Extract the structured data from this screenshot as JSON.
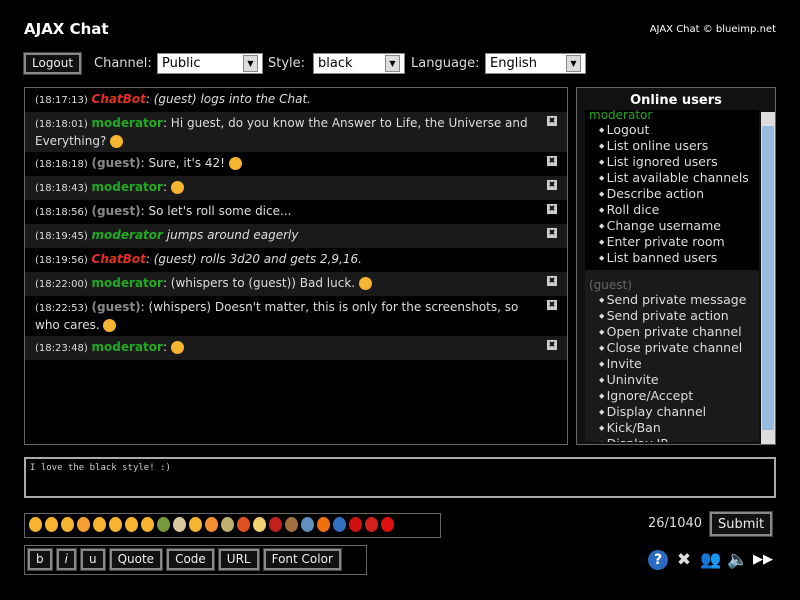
{
  "header": {
    "title": "AJAX Chat",
    "credit": "AJAX Chat © blueimp.net"
  },
  "toolbar": {
    "logout": "Logout",
    "channel_label": "Channel:",
    "channel": "Public",
    "style_label": "Style:",
    "style": "black",
    "language_label": "Language:",
    "language": "English"
  },
  "messages": [
    {
      "time": "(18:17:13)",
      "user": "ChatBot",
      "type": "bot",
      "text": ": (guest) logs into the Chat.",
      "italic": true,
      "del": false
    },
    {
      "time": "(18:18:01)",
      "user": "moderator",
      "type": "mod",
      "text": ": Hi guest, do you know the Answer to Life, the Universe and Everything?",
      "smile": true,
      "del": true
    },
    {
      "time": "(18:18:18)",
      "user": "(guest)",
      "type": "gst",
      "text": ": Sure, it's 42!",
      "smile": true,
      "del": true
    },
    {
      "time": "(18:18:43)",
      "user": "moderator",
      "type": "mod",
      "text": ":",
      "smile": true,
      "del": true
    },
    {
      "time": "(18:18:56)",
      "user": "(guest)",
      "type": "gst",
      "text": ": So let's roll some dice...",
      "del": true
    },
    {
      "time": "(18:19:45)",
      "user": "moderator",
      "type": "modi",
      "text": " jumps around eagerly",
      "italic": true,
      "del": true
    },
    {
      "time": "(18:19:56)",
      "user": "ChatBot",
      "type": "bot",
      "text": ": (guest) rolls 3d20 and gets 2,9,16.",
      "italic": true,
      "del": false
    },
    {
      "time": "(18:22:00)",
      "user": "moderator",
      "type": "mod",
      "text": ": (whispers to (guest)) Bad luck.",
      "smile": true,
      "del": true
    },
    {
      "time": "(18:22:53)",
      "user": "(guest)",
      "type": "gst",
      "text": ": (whispers) Doesn't matter, this is only for the screenshots, so who cares.",
      "smile": true,
      "del": true
    },
    {
      "time": "(18:23:48)",
      "user": "moderator",
      "type": "mod",
      "text": ":",
      "smile": true,
      "del": true
    }
  ],
  "users": {
    "title": "Online users",
    "list": [
      {
        "name": "moderator",
        "menu": [
          "Logout",
          "List online users",
          "List ignored users",
          "List available channels",
          "Describe action",
          "Roll dice",
          "Change username",
          "Enter private room",
          "List banned users"
        ]
      },
      {
        "name": "(guest)",
        "menu": [
          "Send private message",
          "Send private action",
          "Open private channel",
          "Close private channel",
          "Invite",
          "Uninvite",
          "Ignore/Accept",
          "Display channel",
          "Kick/Ban",
          "Display IP"
        ]
      }
    ]
  },
  "input": {
    "value": "I love the black style! :)"
  },
  "emoticon_colors": [
    "#f5b530",
    "#f5b530",
    "#f5b530",
    "#f5a030",
    "#f5b530",
    "#f5b530",
    "#f5b530",
    "#f5b530",
    "#7a9a40",
    "#d8c8a0",
    "#f5b530",
    "#f59030",
    "#c0b070",
    "#e05020",
    "#f0d070",
    "#c02020",
    "#a07040",
    "#6090c0",
    "#f07010",
    "#3070c0",
    "#d01010",
    "#d02020",
    "#e01010"
  ],
  "format": {
    "bold": "b",
    "italic": "i",
    "underline": "u",
    "quote": "Quote",
    "code": "Code",
    "url": "URL",
    "font_color": "Font Color"
  },
  "counter": "26/1040",
  "submit": "Submit"
}
